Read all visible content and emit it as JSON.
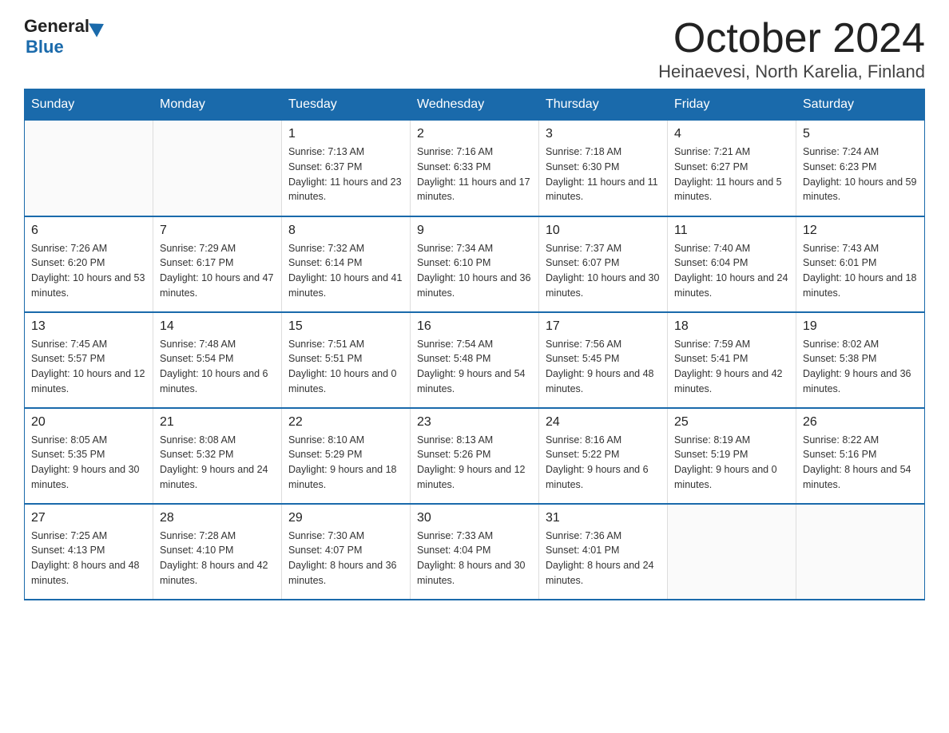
{
  "logo": {
    "general": "General",
    "blue": "Blue"
  },
  "title": "October 2024",
  "subtitle": "Heinaevesi, North Karelia, Finland",
  "days_header": [
    "Sunday",
    "Monday",
    "Tuesday",
    "Wednesday",
    "Thursday",
    "Friday",
    "Saturday"
  ],
  "weeks": [
    [
      {
        "date": "",
        "sunrise": "",
        "sunset": "",
        "daylight": ""
      },
      {
        "date": "",
        "sunrise": "",
        "sunset": "",
        "daylight": ""
      },
      {
        "date": "1",
        "sunrise": "Sunrise: 7:13 AM",
        "sunset": "Sunset: 6:37 PM",
        "daylight": "Daylight: 11 hours and 23 minutes."
      },
      {
        "date": "2",
        "sunrise": "Sunrise: 7:16 AM",
        "sunset": "Sunset: 6:33 PM",
        "daylight": "Daylight: 11 hours and 17 minutes."
      },
      {
        "date": "3",
        "sunrise": "Sunrise: 7:18 AM",
        "sunset": "Sunset: 6:30 PM",
        "daylight": "Daylight: 11 hours and 11 minutes."
      },
      {
        "date": "4",
        "sunrise": "Sunrise: 7:21 AM",
        "sunset": "Sunset: 6:27 PM",
        "daylight": "Daylight: 11 hours and 5 minutes."
      },
      {
        "date": "5",
        "sunrise": "Sunrise: 7:24 AM",
        "sunset": "Sunset: 6:23 PM",
        "daylight": "Daylight: 10 hours and 59 minutes."
      }
    ],
    [
      {
        "date": "6",
        "sunrise": "Sunrise: 7:26 AM",
        "sunset": "Sunset: 6:20 PM",
        "daylight": "Daylight: 10 hours and 53 minutes."
      },
      {
        "date": "7",
        "sunrise": "Sunrise: 7:29 AM",
        "sunset": "Sunset: 6:17 PM",
        "daylight": "Daylight: 10 hours and 47 minutes."
      },
      {
        "date": "8",
        "sunrise": "Sunrise: 7:32 AM",
        "sunset": "Sunset: 6:14 PM",
        "daylight": "Daylight: 10 hours and 41 minutes."
      },
      {
        "date": "9",
        "sunrise": "Sunrise: 7:34 AM",
        "sunset": "Sunset: 6:10 PM",
        "daylight": "Daylight: 10 hours and 36 minutes."
      },
      {
        "date": "10",
        "sunrise": "Sunrise: 7:37 AM",
        "sunset": "Sunset: 6:07 PM",
        "daylight": "Daylight: 10 hours and 30 minutes."
      },
      {
        "date": "11",
        "sunrise": "Sunrise: 7:40 AM",
        "sunset": "Sunset: 6:04 PM",
        "daylight": "Daylight: 10 hours and 24 minutes."
      },
      {
        "date": "12",
        "sunrise": "Sunrise: 7:43 AM",
        "sunset": "Sunset: 6:01 PM",
        "daylight": "Daylight: 10 hours and 18 minutes."
      }
    ],
    [
      {
        "date": "13",
        "sunrise": "Sunrise: 7:45 AM",
        "sunset": "Sunset: 5:57 PM",
        "daylight": "Daylight: 10 hours and 12 minutes."
      },
      {
        "date": "14",
        "sunrise": "Sunrise: 7:48 AM",
        "sunset": "Sunset: 5:54 PM",
        "daylight": "Daylight: 10 hours and 6 minutes."
      },
      {
        "date": "15",
        "sunrise": "Sunrise: 7:51 AM",
        "sunset": "Sunset: 5:51 PM",
        "daylight": "Daylight: 10 hours and 0 minutes."
      },
      {
        "date": "16",
        "sunrise": "Sunrise: 7:54 AM",
        "sunset": "Sunset: 5:48 PM",
        "daylight": "Daylight: 9 hours and 54 minutes."
      },
      {
        "date": "17",
        "sunrise": "Sunrise: 7:56 AM",
        "sunset": "Sunset: 5:45 PM",
        "daylight": "Daylight: 9 hours and 48 minutes."
      },
      {
        "date": "18",
        "sunrise": "Sunrise: 7:59 AM",
        "sunset": "Sunset: 5:41 PM",
        "daylight": "Daylight: 9 hours and 42 minutes."
      },
      {
        "date": "19",
        "sunrise": "Sunrise: 8:02 AM",
        "sunset": "Sunset: 5:38 PM",
        "daylight": "Daylight: 9 hours and 36 minutes."
      }
    ],
    [
      {
        "date": "20",
        "sunrise": "Sunrise: 8:05 AM",
        "sunset": "Sunset: 5:35 PM",
        "daylight": "Daylight: 9 hours and 30 minutes."
      },
      {
        "date": "21",
        "sunrise": "Sunrise: 8:08 AM",
        "sunset": "Sunset: 5:32 PM",
        "daylight": "Daylight: 9 hours and 24 minutes."
      },
      {
        "date": "22",
        "sunrise": "Sunrise: 8:10 AM",
        "sunset": "Sunset: 5:29 PM",
        "daylight": "Daylight: 9 hours and 18 minutes."
      },
      {
        "date": "23",
        "sunrise": "Sunrise: 8:13 AM",
        "sunset": "Sunset: 5:26 PM",
        "daylight": "Daylight: 9 hours and 12 minutes."
      },
      {
        "date": "24",
        "sunrise": "Sunrise: 8:16 AM",
        "sunset": "Sunset: 5:22 PM",
        "daylight": "Daylight: 9 hours and 6 minutes."
      },
      {
        "date": "25",
        "sunrise": "Sunrise: 8:19 AM",
        "sunset": "Sunset: 5:19 PM",
        "daylight": "Daylight: 9 hours and 0 minutes."
      },
      {
        "date": "26",
        "sunrise": "Sunrise: 8:22 AM",
        "sunset": "Sunset: 5:16 PM",
        "daylight": "Daylight: 8 hours and 54 minutes."
      }
    ],
    [
      {
        "date": "27",
        "sunrise": "Sunrise: 7:25 AM",
        "sunset": "Sunset: 4:13 PM",
        "daylight": "Daylight: 8 hours and 48 minutes."
      },
      {
        "date": "28",
        "sunrise": "Sunrise: 7:28 AM",
        "sunset": "Sunset: 4:10 PM",
        "daylight": "Daylight: 8 hours and 42 minutes."
      },
      {
        "date": "29",
        "sunrise": "Sunrise: 7:30 AM",
        "sunset": "Sunset: 4:07 PM",
        "daylight": "Daylight: 8 hours and 36 minutes."
      },
      {
        "date": "30",
        "sunrise": "Sunrise: 7:33 AM",
        "sunset": "Sunset: 4:04 PM",
        "daylight": "Daylight: 8 hours and 30 minutes."
      },
      {
        "date": "31",
        "sunrise": "Sunrise: 7:36 AM",
        "sunset": "Sunset: 4:01 PM",
        "daylight": "Daylight: 8 hours and 24 minutes."
      },
      {
        "date": "",
        "sunrise": "",
        "sunset": "",
        "daylight": ""
      },
      {
        "date": "",
        "sunrise": "",
        "sunset": "",
        "daylight": ""
      }
    ]
  ]
}
